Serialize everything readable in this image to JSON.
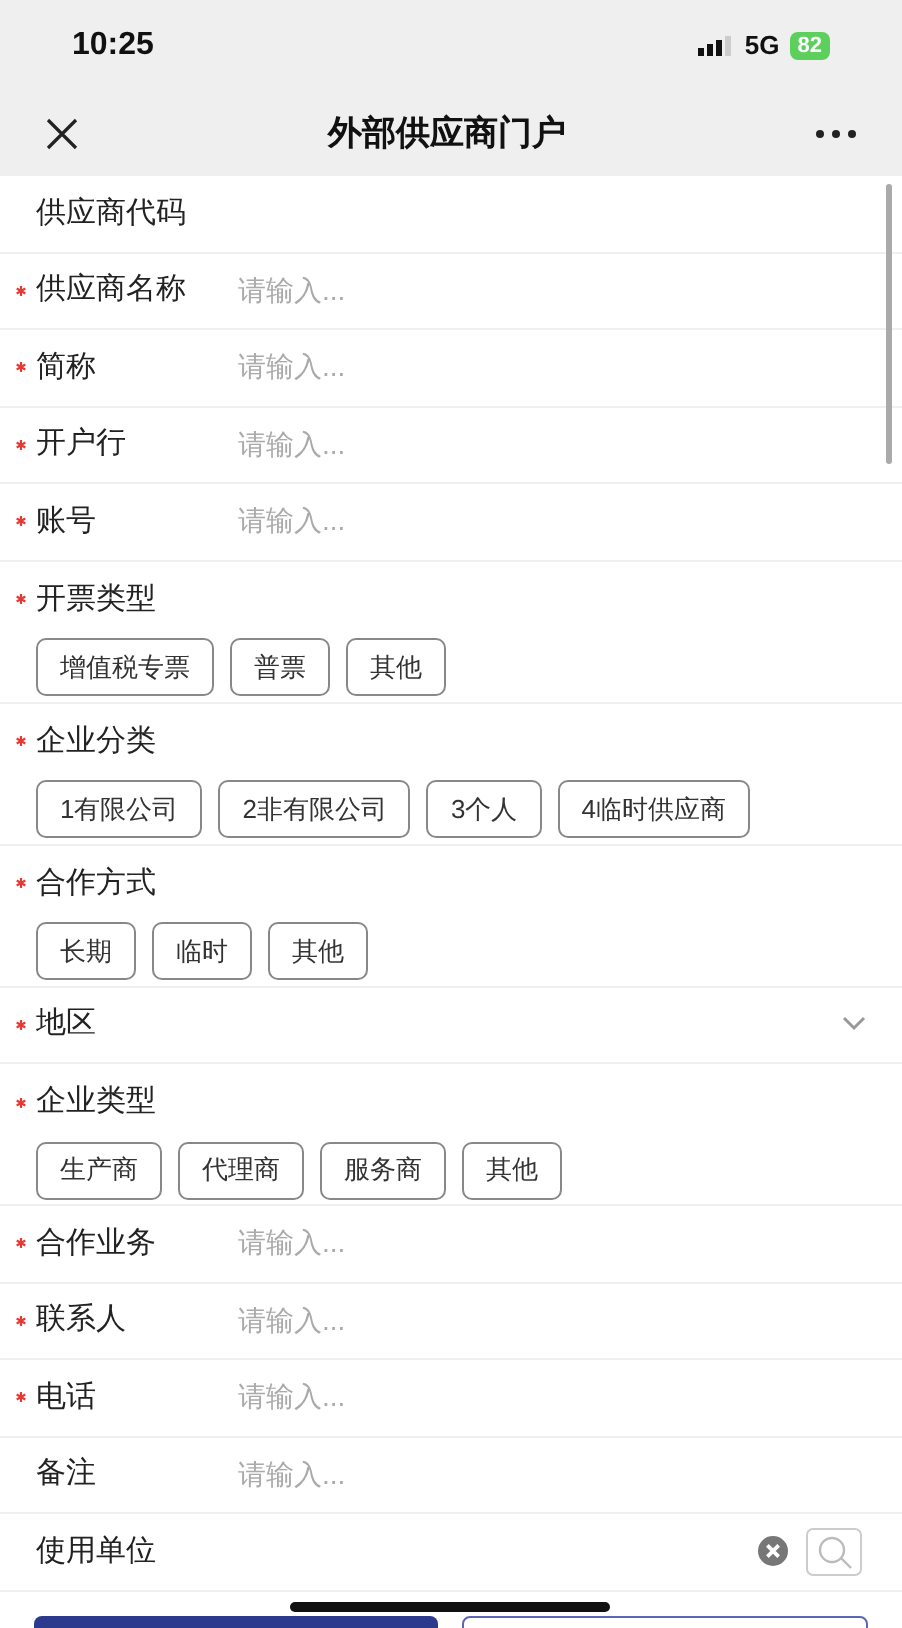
{
  "status_bar": {
    "time": "10:25",
    "network": "5G",
    "battery": "82"
  },
  "header": {
    "title": "外部供应商门户"
  },
  "form": [
    {
      "kind": "field",
      "label": "供应商代码",
      "required": false
    },
    {
      "kind": "field",
      "label": "供应商名称",
      "required": true,
      "placeholder": "请输入..."
    },
    {
      "kind": "field",
      "label": "简称",
      "required": true,
      "placeholder": "请输入..."
    },
    {
      "kind": "field",
      "label": "开户行",
      "required": true,
      "placeholder": "请输入..."
    },
    {
      "kind": "field",
      "label": "账号",
      "required": true,
      "placeholder": "请输入..."
    },
    {
      "kind": "tags",
      "label": "开票类型",
      "required": true,
      "options": [
        {
          "label": "增值税专票",
          "selected": false
        },
        {
          "label": "普票",
          "selected": false
        },
        {
          "label": "其他",
          "selected": false
        }
      ]
    },
    {
      "kind": "tags",
      "label": "企业分类",
      "required": true,
      "options": [
        {
          "label": "1有限公司",
          "selected": false
        },
        {
          "label": "2非有限公司",
          "selected": false
        },
        {
          "label": "3个人",
          "selected": false
        },
        {
          "label": "4临时供应商",
          "selected": false
        }
      ]
    },
    {
      "kind": "tags",
      "label": "合作方式",
      "required": true,
      "options": [
        {
          "label": "长期",
          "selected": false
        },
        {
          "label": "临时",
          "selected": false
        },
        {
          "label": "其他",
          "selected": false
        }
      ]
    },
    {
      "kind": "select",
      "label": "地区",
      "required": true
    },
    {
      "kind": "tags",
      "label": "企业类型",
      "required": true,
      "options": [
        {
          "label": "生产商",
          "selected": false
        },
        {
          "label": "代理商",
          "selected": false
        },
        {
          "label": "服务商",
          "selected": false
        },
        {
          "label": "其他",
          "selected": false
        }
      ]
    },
    {
      "kind": "field",
      "label": "合作业务",
      "required": true,
      "placeholder": "请输入..."
    },
    {
      "kind": "field",
      "label": "联系人",
      "required": true,
      "placeholder": "请输入..."
    },
    {
      "kind": "field",
      "label": "电话",
      "required": true,
      "placeholder": "请输入..."
    },
    {
      "kind": "field",
      "label": "备注",
      "required": false,
      "placeholder": "请输入..."
    },
    {
      "kind": "lookup",
      "label": "使用单位",
      "required": false
    }
  ]
}
